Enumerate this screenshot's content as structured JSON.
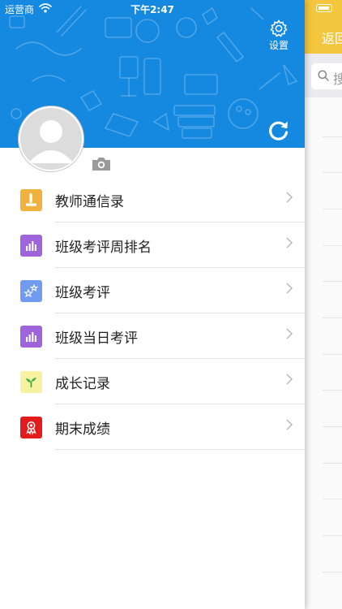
{
  "status_bar": {
    "carrier": "运营商",
    "time": "下午2:47"
  },
  "header": {
    "settings_label": "设置",
    "background_color": "#1589e0"
  },
  "menu": {
    "items": [
      {
        "label": "教师通信录",
        "icon": "teacher-contacts-icon",
        "color": "#f0b23c"
      },
      {
        "label": "班级考评周排名",
        "icon": "bar-chart-icon",
        "color": "#9f63dc"
      },
      {
        "label": "班级考评",
        "icon": "stars-icon",
        "color": "#6f9cf0"
      },
      {
        "label": "班级当日考评",
        "icon": "bar-chart-icon",
        "color": "#9f63dc"
      },
      {
        "label": "成长记录",
        "icon": "sprout-icon",
        "color": "#f7f2a0"
      },
      {
        "label": "期末成绩",
        "icon": "award-icon",
        "color": "#e21b1b"
      }
    ]
  },
  "background_page": {
    "back_label": "返回",
    "search_placeholder": "搜",
    "accent_color": "#f4c63d"
  }
}
